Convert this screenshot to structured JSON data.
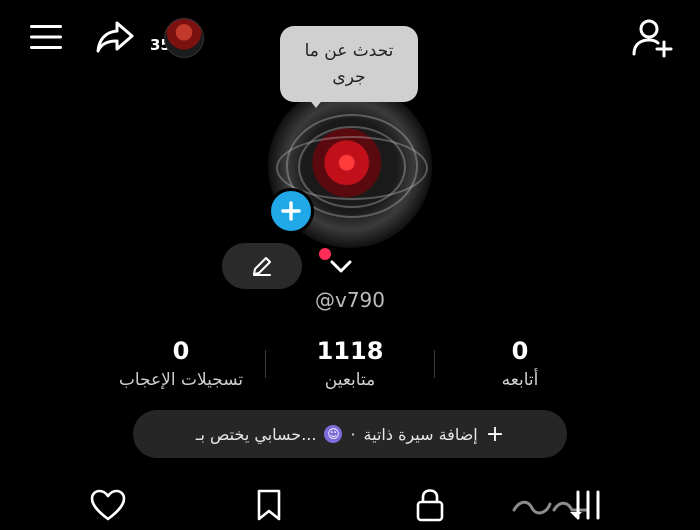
{
  "header": {
    "friend_count": "35",
    "icons": [
      "menu-icon",
      "share-icon",
      "add-friend-icon"
    ]
  },
  "profile": {
    "note_line1": "تحدث عن ما",
    "note_line2": "جرى",
    "username": "@v790"
  },
  "stats": {
    "following": {
      "value": "0",
      "label": "أتابعه"
    },
    "followers": {
      "value": "1118",
      "label": "متابعين"
    },
    "likes": {
      "value": "0",
      "label": "تسجيلات الإعجاب"
    }
  },
  "bio": {
    "add_bio": "إضافة سيرة ذاتية",
    "separator": "·",
    "account_summary": "حسابي يختص بـ..."
  },
  "colors": {
    "accent_blue": "#20a8e8",
    "status_dot": "#ff2d55",
    "bubble_bg": "#d0d0d0"
  }
}
